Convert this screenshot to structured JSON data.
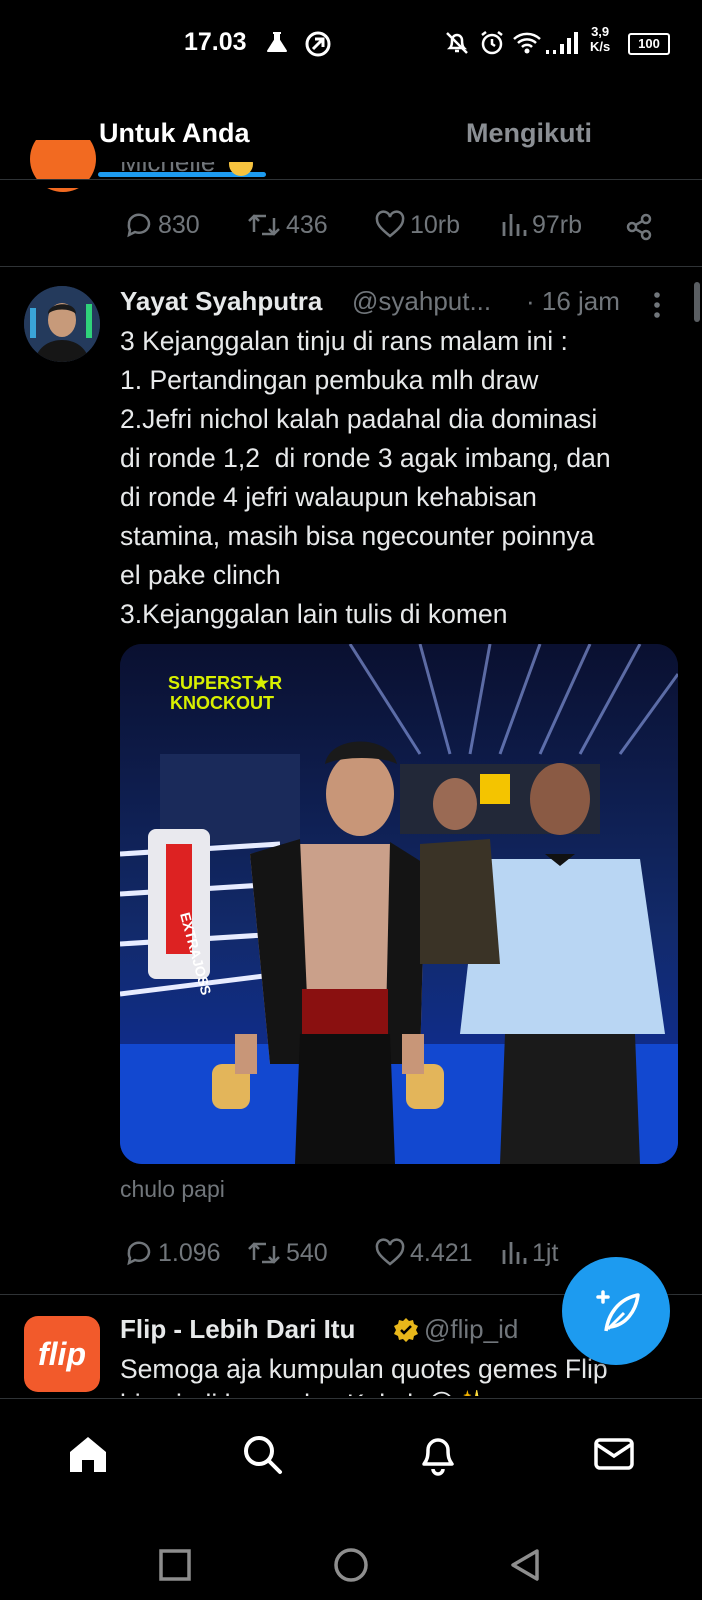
{
  "status_bar": {
    "time": "17.03",
    "net_speed_value": "3,9",
    "net_speed_unit": "K/s",
    "battery": "100"
  },
  "tabs": [
    {
      "label": "Untuk Anda",
      "active": true
    },
    {
      "label": "Mengikuti",
      "active": false
    }
  ],
  "prev_tweet": {
    "text_fragment": "Michelle",
    "metrics": {
      "replies": "830",
      "retweets": "436",
      "likes": "10rb",
      "views": "97rb"
    }
  },
  "tweet": {
    "name": "Yayat Syahputra",
    "handle": "@syahput...",
    "time": "· 16 jam",
    "lines": [
      "3 Kejanggalan tinju di rans malam ini :",
      "1. Pertandingan pembuka mlh draw",
      "2.Jefri nichol kalah padahal dia dominasi",
      "di ronde 1,2  di ronde 3 agak imbang, dan",
      "di ronde 4 jefri walaupun kehabisan",
      "stamina, masih bisa ngecounter poinnya",
      "el pake clinch",
      "3.Kejanggalan lain tulis di komen"
    ],
    "media": {
      "logo_line1": "SUPERST★R",
      "logo_line2": "KNOCKOUT",
      "ring_banner": "EXTRAJOSS"
    },
    "media_caption": "chulo papi",
    "metrics": {
      "replies": "1.096",
      "retweets": "540",
      "likes": "4.421",
      "views": "1jt"
    }
  },
  "next_tweet": {
    "avatar_text": "flip",
    "name": "Flip - Lebih Dari Itu",
    "handle": "@flip_id",
    "text": "Semoga aja kumpulan quotes gemes Flip",
    "text_line2": "bisa jadi kumpulan Kakak 😊✨"
  },
  "nav": [
    "home-icon",
    "search-icon",
    "notifications-icon",
    "messages-icon"
  ],
  "colors": {
    "accent": "#1d9bf0",
    "background": "#000000",
    "muted": "#71767b",
    "flip_orange": "#f25a2b"
  }
}
